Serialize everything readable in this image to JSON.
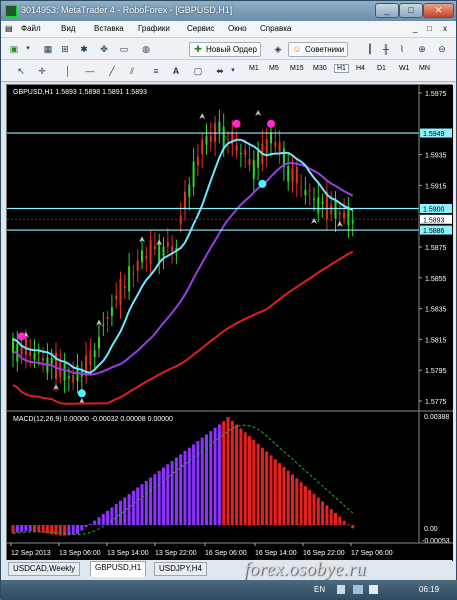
{
  "window": {
    "title": "3014953: MetaTrader 4 - RoboForex - [GBPUSD,H1]",
    "min_label": "_",
    "max_label": "□",
    "close_label": "✕"
  },
  "menu": {
    "items": [
      "Файл",
      "Вид",
      "Вставка",
      "Графики",
      "Сервис",
      "Окно",
      "Справка"
    ],
    "right_controls": [
      "_",
      "□",
      "x"
    ]
  },
  "toolbar": {
    "new_order_label": "Новый Ордер",
    "advisors_label": "Советники",
    "timeframes": [
      "M1",
      "M5",
      "M15",
      "M30",
      "H1",
      "H4",
      "D1",
      "W1",
      "MN"
    ],
    "active_timeframe": "H1"
  },
  "chart": {
    "header": "GBPUSD,H1  1.5893 1.5898 1.5891 1.5893",
    "price_labels": [
      "1.5975",
      "1.5949",
      "1.5935",
      "1.5915",
      "1.5900",
      "1.5893",
      "1.5886",
      "1.5875",
      "1.5855",
      "1.5835",
      "1.5815",
      "1.5795",
      "1.5775"
    ],
    "hlines": [
      {
        "price": "1.5949",
        "color": "#8cf2ff"
      },
      {
        "price": "1.5900",
        "color": "#8cf2ff"
      },
      {
        "price": "1.5886",
        "color": "#8cf2ff"
      }
    ],
    "current_price": "1.5893",
    "macd_header": "MACD(12,26,9)  0.00000  -0.00032  0.00008  0.00000",
    "macd_labels": [
      "0.00388",
      "0.00",
      "-0.00053"
    ],
    "time_labels": [
      "12 Sep 2013",
      "13 Sep 06:00",
      "13 Sep 14:00",
      "13 Sep 22:00",
      "16 Sep 06:00",
      "16 Sep 14:00",
      "16 Sep 22:00",
      "17 Sep 06:00"
    ]
  },
  "tabs": [
    {
      "label": "USDCAD,Weekly",
      "active": false
    },
    {
      "label": "GBPUSD,H1",
      "active": true
    },
    {
      "label": "USDJPY,H4",
      "active": false
    }
  ],
  "watermark": "forex.osobye.ru",
  "taskbar": {
    "lang": "EN",
    "clock": "06:19"
  },
  "colors": {
    "bull": "#2ed52e",
    "bear": "#e03030",
    "cyan_ma": "#6fe6ff",
    "purple_ma": "#9b3de0",
    "red_ma": "#e01e1e",
    "macd_purple": "#8b33ff",
    "macd_red": "#e82020",
    "marker_magenta": "#ff2bd6",
    "marker_cyan": "#4ef2ff"
  }
}
